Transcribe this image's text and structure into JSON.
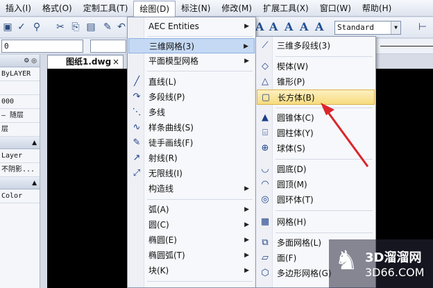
{
  "menubar": {
    "items": [
      "插入(I)",
      "格式(O)",
      "定制工具(T)",
      "绘图(D)",
      "标注(N)",
      "修改(M)",
      "扩展工具(X)",
      "窗口(W)",
      "帮助(H)"
    ]
  },
  "toolbar": {
    "text_style": "Standard",
    "layer_value": "0"
  },
  "left_panel": {
    "rows": [
      "ByLAYER",
      "",
      "000",
      "— 随层",
      "层",
      "",
      "Layer",
      "不阴影...",
      "",
      "Color"
    ]
  },
  "drawing_tab": {
    "title": "图纸1.dwg",
    "close": "×"
  },
  "draw_menu": {
    "items": [
      {
        "label": "AEC Entities",
        "has_sub": true,
        "icon": ""
      },
      {
        "label": "三维网格(3)",
        "has_sub": true,
        "icon": ""
      },
      {
        "label": "平面模型网格",
        "has_sub": true,
        "icon": ""
      },
      {
        "label": "直线(L)",
        "has_sub": false,
        "icon": "line-icon"
      },
      {
        "label": "多段线(P)",
        "has_sub": false,
        "icon": "polyline-icon"
      },
      {
        "label": "多线",
        "has_sub": false,
        "icon": "multiline-icon"
      },
      {
        "label": "样条曲线(S)",
        "has_sub": false,
        "icon": "spline-icon"
      },
      {
        "label": "徒手画线(F)",
        "has_sub": false,
        "icon": "freehand-icon"
      },
      {
        "label": "射线(R)",
        "has_sub": false,
        "icon": "ray-icon"
      },
      {
        "label": "无限线(I)",
        "has_sub": false,
        "icon": "xline-icon"
      },
      {
        "label": "构造线",
        "has_sub": true,
        "icon": ""
      },
      {
        "label": "弧(A)",
        "has_sub": true,
        "icon": ""
      },
      {
        "label": "圆(C)",
        "has_sub": true,
        "icon": ""
      },
      {
        "label": "椭圆(E)",
        "has_sub": true,
        "icon": ""
      },
      {
        "label": "椭圆弧(T)",
        "has_sub": true,
        "icon": ""
      },
      {
        "label": "块(K)",
        "has_sub": true,
        "icon": ""
      }
    ]
  },
  "mesh_submenu": {
    "items": [
      {
        "label": "三维多段线(3)",
        "icon": "3d-polyline-icon"
      },
      {
        "label": "楔体(W)",
        "icon": "wedge-icon"
      },
      {
        "label": "锥形(P)",
        "icon": "pyramid-icon"
      },
      {
        "label": "长方体(B)",
        "icon": "box-icon"
      },
      {
        "label": "圆锥体(C)",
        "icon": "cone-icon"
      },
      {
        "label": "圆柱体(Y)",
        "icon": "cylinder-icon"
      },
      {
        "label": "球体(S)",
        "icon": "sphere-icon"
      },
      {
        "label": "圆底(D)",
        "icon": "dish-icon"
      },
      {
        "label": "圆顶(M)",
        "icon": "dome-icon"
      },
      {
        "label": "圆环体(T)",
        "icon": "torus-icon"
      },
      {
        "label": "网格(H)",
        "icon": "mesh-icon"
      },
      {
        "label": "多面网格(L)",
        "icon": "polyface-icon"
      },
      {
        "label": "面(F)",
        "icon": "face-icon"
      },
      {
        "label": "多边形网格(G)",
        "icon": "polygon-mesh-icon"
      }
    ],
    "highlighted": "长方体(B)"
  },
  "watermark": {
    "brand": "3D溜溜网",
    "site": "3D66.COM"
  },
  "colors": {
    "highlight_submenu": "#f7dc7e",
    "highlight_menu": "#c5d9f4",
    "arrow": "#d9262c"
  }
}
